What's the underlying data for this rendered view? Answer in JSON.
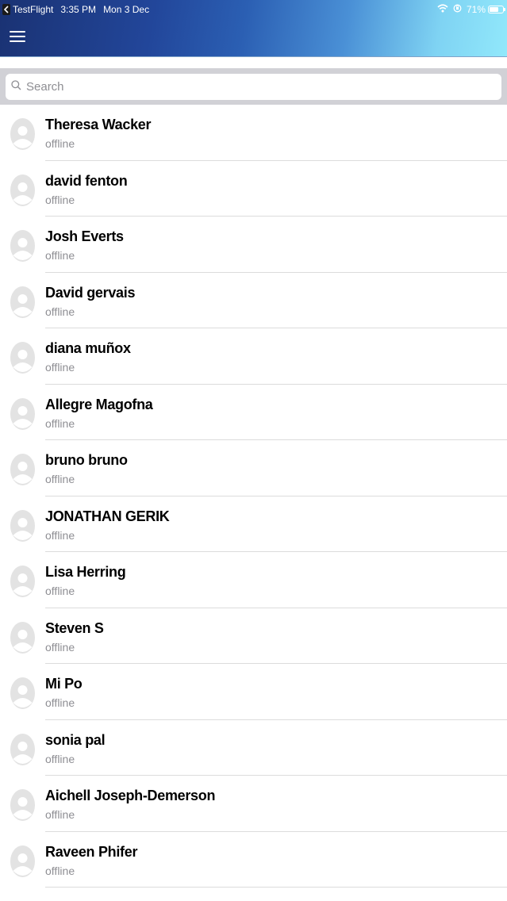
{
  "status_bar": {
    "carrier": "TestFlight",
    "time": "3:35 PM",
    "date": "Mon 3 Dec",
    "battery": "71%",
    "battery_level": 0.71
  },
  "header": {
    "gradient_start": "#1a3273",
    "gradient_end": "#91e8fb",
    "menu_icon": "hamburger-menu-icon"
  },
  "search": {
    "placeholder": "Search",
    "value": "",
    "icon": "search-icon"
  },
  "contacts": [
    {
      "name": "Theresa Wacker",
      "status": "offline"
    },
    {
      "name": "david fenton",
      "status": "offline"
    },
    {
      "name": "Josh Everts",
      "status": "offline"
    },
    {
      "name": "David gervais",
      "status": "offline"
    },
    {
      "name": "diana muñox",
      "status": "offline"
    },
    {
      "name": "Allegre Magofna",
      "status": "offline"
    },
    {
      "name": "bruno bruno",
      "status": "offline"
    },
    {
      "name": "JONATHAN GERIK",
      "status": "offline"
    },
    {
      "name": "Lisa Herring",
      "status": "offline"
    },
    {
      "name": "Steven S",
      "status": "offline"
    },
    {
      "name": "Mi Po",
      "status": "offline"
    },
    {
      "name": "sonia pal",
      "status": "offline"
    },
    {
      "name": "Aichell Joseph-Demerson",
      "status": "offline"
    },
    {
      "name": "Raveen Phifer",
      "status": "offline"
    },
    {
      "name": "",
      "status": ""
    }
  ],
  "colors": {
    "status_offline": "#8e8e93",
    "separator": "#dcdcdc",
    "search_background": "#d1d1d6"
  }
}
